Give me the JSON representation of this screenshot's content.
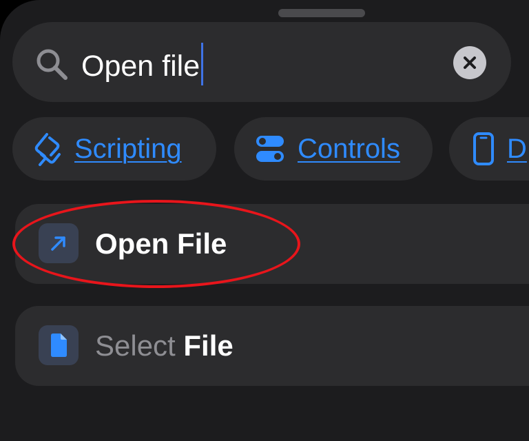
{
  "search": {
    "query": "Open file",
    "icon": "search-icon",
    "clear_icon": "close-icon"
  },
  "categories": [
    {
      "label": "Scripting",
      "icon": "scripting-icon"
    },
    {
      "label": "Controls",
      "icon": "controls-icon"
    },
    {
      "label": "D",
      "icon": "device-icon"
    }
  ],
  "results": [
    {
      "label": "Open File",
      "icon": "arrow-up-right-icon"
    },
    {
      "label_prefix": "Select",
      "label_match": "File",
      "icon": "document-icon"
    }
  ],
  "colors": {
    "accent": "#2f8bff",
    "background": "#1c1c1e",
    "surface": "#2c2c2e",
    "highlight_annotation": "#e8151b"
  }
}
